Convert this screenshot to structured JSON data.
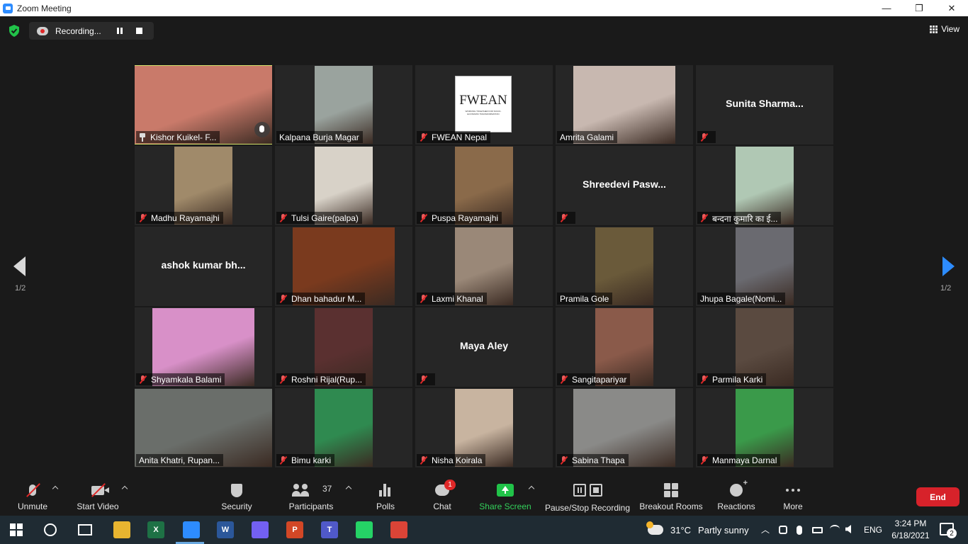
{
  "window": {
    "title": "Zoom Meeting",
    "minimize": "—",
    "restore": "❐",
    "close": "✕"
  },
  "topbar": {
    "recording_label": "Recording...",
    "view_label": "View"
  },
  "tiles": [
    {
      "name": "Kishor Kuikel- F...",
      "video": true,
      "active": true,
      "pinned": true,
      "muted": false,
      "bg": "#c97a6a"
    },
    {
      "name": "Kalpana Burja Magar",
      "video": true,
      "muted": false,
      "bg": "#9aa39e"
    },
    {
      "name": "FWEAN Nepal",
      "logo": true,
      "muted": true
    },
    {
      "name": "Amrita Galami",
      "video": true,
      "muted": false,
      "bg": "#c8b8b0"
    },
    {
      "name": "Sunita Sharma...",
      "video": false,
      "muted": true
    },
    {
      "name": "Madhu Rayamajhi",
      "video": true,
      "muted": true,
      "bg": "#a08a6a"
    },
    {
      "name": "Tulsi Gaire(palpa)",
      "video": true,
      "muted": true,
      "bg": "#d8d2c8"
    },
    {
      "name": "Puspa Rayamajhi",
      "video": true,
      "muted": true,
      "bg": "#8a6a4a"
    },
    {
      "name": "Shreedevi Pasw...",
      "video": false,
      "muted": true
    },
    {
      "name": "बन्दना कुमारि का ई...",
      "video": true,
      "muted": true,
      "bg": "#b0c8b4"
    },
    {
      "name": "ashok kumar bh...",
      "video": false,
      "muted": false,
      "noname": true
    },
    {
      "name": "Dhan bahadur M...",
      "video": true,
      "muted": true,
      "bg": "#7a3a1e"
    },
    {
      "name": "Laxmi Khanal",
      "video": true,
      "muted": true,
      "bg": "#9a8878"
    },
    {
      "name": "Pramila Gole",
      "video": true,
      "muted": false,
      "bg": "#6a5a3a"
    },
    {
      "name": "Jhupa Bagale(Nomi...",
      "video": true,
      "muted": false,
      "bg": "#6a6a70"
    },
    {
      "name": "Shyamkala Balami",
      "video": true,
      "muted": true,
      "bg": "#d890c8"
    },
    {
      "name": "Roshni Rijal(Rup...",
      "video": true,
      "muted": true,
      "bg": "#5a3030"
    },
    {
      "name": "Maya Aley",
      "video": false,
      "muted": true
    },
    {
      "name": "Sangitapariyar",
      "video": true,
      "muted": true,
      "bg": "#8a5a4a"
    },
    {
      "name": "Parmila Karki",
      "video": true,
      "muted": true,
      "bg": "#5a4a40"
    },
    {
      "name": "Anita Khatri, Rupan...",
      "video": true,
      "muted": false,
      "bg": "#6a6e6a"
    },
    {
      "name": "Bimu karki",
      "video": true,
      "muted": true,
      "bg": "#2f8a50"
    },
    {
      "name": "Nisha Koirala",
      "video": true,
      "muted": true,
      "bg": "#c8b4a0"
    },
    {
      "name": "Sabina Thapa",
      "video": true,
      "muted": true,
      "bg": "#8a8a88"
    },
    {
      "name": "Manmaya Darnal",
      "video": true,
      "muted": true,
      "bg": "#3a9a4a"
    }
  ],
  "fwean": {
    "logo_text": "FWEAN",
    "tagline": "WORKING TOGETHER FOR SOCIO-ECONOMIC TRANSFORMATION"
  },
  "pager": {
    "left": "1/2",
    "right": "1/2"
  },
  "toolbar": {
    "unmute": "Unmute",
    "start_video": "Start Video",
    "security": "Security",
    "participants": "Participants",
    "participants_count": "37",
    "polls": "Polls",
    "chat": "Chat",
    "chat_badge": "1",
    "share_screen": "Share Screen",
    "pause_recording": "Pause/Stop Recording",
    "breakout": "Breakout Rooms",
    "reactions": "Reactions",
    "more": "More",
    "end": "End"
  },
  "taskbar": {
    "weather_temp": "31°C",
    "weather_desc": "Partly sunny",
    "lang": "ENG",
    "time": "3:24 PM",
    "date": "6/18/2021",
    "notif_count": "2",
    "apps": [
      {
        "name": "file-explorer",
        "label": "",
        "color": "#e8b530"
      },
      {
        "name": "excel",
        "label": "X",
        "color": "#1e7145"
      },
      {
        "name": "zoom",
        "label": "",
        "color": "#2d8cff"
      },
      {
        "name": "word",
        "label": "W",
        "color": "#2b579a"
      },
      {
        "name": "viber",
        "label": "",
        "color": "#7360f2"
      },
      {
        "name": "powerpoint",
        "label": "P",
        "color": "#d24726"
      },
      {
        "name": "teams",
        "label": "T",
        "color": "#5059c9"
      },
      {
        "name": "whatsapp",
        "label": "",
        "color": "#25d366"
      },
      {
        "name": "chrome",
        "label": "",
        "color": "#db4437"
      }
    ]
  }
}
